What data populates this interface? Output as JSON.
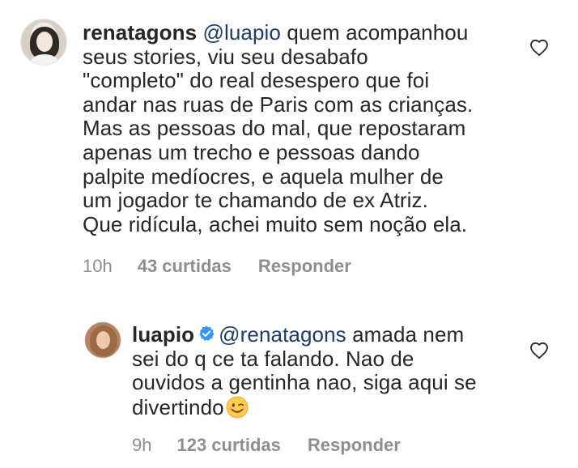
{
  "comments": [
    {
      "username": "renatagons",
      "mention": "@luapio",
      "text": "quem acompanhou\nseus stories, viu  seu desabafo\n\"completo\" do real desespero que foi\nandar nas ruas de Paris com as crianças.\nMas as pessoas do mal, que repostaram\napenas um trecho e pessoas dando\npalpite medíocres, e aquela mulher de\num jogador te chamando de ex Atriz.\nQue ridícula, achei muito sem noção ela.",
      "time": "10h",
      "likes": "43 curtidas",
      "reply_label": "Responder"
    },
    {
      "username": "luapio",
      "verified": true,
      "mention": "@renatagons",
      "text": "amada nem\nsei do q ce ta falando. Nao de\nouvidos a gentinha nao, siga aqui se\ndivertindo",
      "emoji": "winking-face",
      "time": "9h",
      "likes": "123 curtidas",
      "reply_label": "Responder"
    }
  ],
  "colors": {
    "text": "#262626",
    "mention": "#1f3b65",
    "meta": "#8e8e8e",
    "verified": "#3897f0"
  }
}
